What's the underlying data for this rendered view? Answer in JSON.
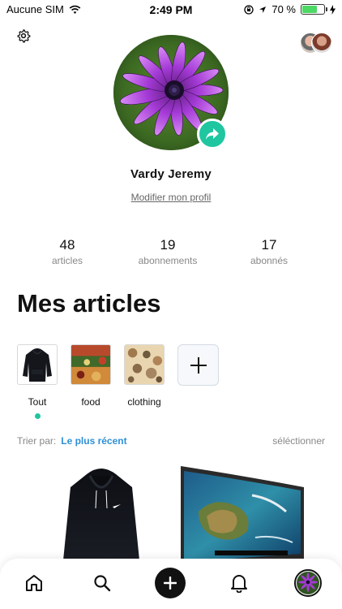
{
  "status_bar": {
    "carrier": "Aucune SIM",
    "time": "2:49 PM",
    "battery": "70 %",
    "battery_level": 0.7,
    "icons": [
      "wifi-icon",
      "orientation-lock-icon",
      "location-icon",
      "battery-icon",
      "charging-icon"
    ]
  },
  "header": {
    "settings_icon": "gear-icon",
    "friends_icon": "friends-avatars"
  },
  "profile": {
    "name": "Vardy Jeremy",
    "edit_label": "Modifier mon profil",
    "share_icon": "share-arrow-icon",
    "accent_color": "#1fc6a0"
  },
  "stats": [
    {
      "value": "48",
      "label": "articles"
    },
    {
      "value": "19",
      "label": "abonnements"
    },
    {
      "value": "17",
      "label": "abonnés"
    }
  ],
  "articles": {
    "title": "Mes articles",
    "categories": [
      {
        "label": "Tout",
        "selected": true
      },
      {
        "label": "food",
        "selected": false
      },
      {
        "label": "clothing",
        "selected": false
      }
    ],
    "add_icon": "plus-icon"
  },
  "sort": {
    "label": "Trier par:",
    "value": "Le plus récent",
    "select_label": "séléctionner",
    "value_color": "#2f8fd6"
  },
  "nav": {
    "items": [
      "home-icon",
      "search-icon",
      "plus-icon",
      "bell-icon",
      "profile-avatar"
    ]
  }
}
